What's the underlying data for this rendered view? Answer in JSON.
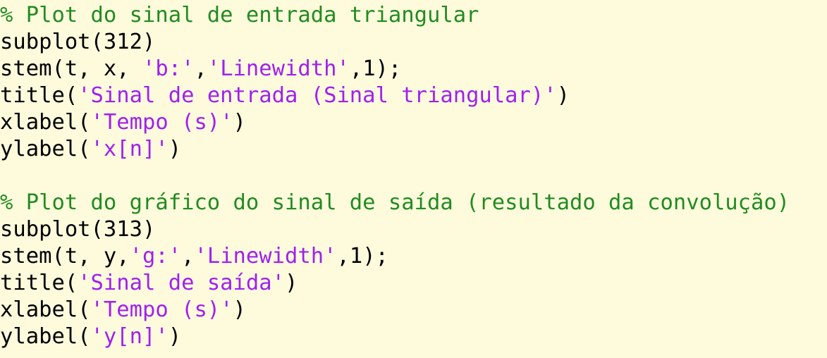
{
  "colors": {
    "background": "#fdfbdc",
    "code": "#000000",
    "comment": "#228b22",
    "string": "#a020f0"
  },
  "lines": [
    [
      {
        "t": "comment",
        "s": "% Plot do sinal de entrada triangular"
      }
    ],
    [
      {
        "t": "plain",
        "s": "subplot(312)"
      }
    ],
    [
      {
        "t": "plain",
        "s": "stem(t, x, "
      },
      {
        "t": "string",
        "s": "'b:'"
      },
      {
        "t": "plain",
        "s": ","
      },
      {
        "t": "string",
        "s": "'Linewidth'"
      },
      {
        "t": "plain",
        "s": ",1);"
      }
    ],
    [
      {
        "t": "plain",
        "s": "title("
      },
      {
        "t": "string",
        "s": "'Sinal de entrada (Sinal triangular)'"
      },
      {
        "t": "plain",
        "s": ")"
      }
    ],
    [
      {
        "t": "plain",
        "s": "xlabel("
      },
      {
        "t": "string",
        "s": "'Tempo (s)'"
      },
      {
        "t": "plain",
        "s": ")"
      }
    ],
    [
      {
        "t": "plain",
        "s": "ylabel("
      },
      {
        "t": "string",
        "s": "'x[n]'"
      },
      {
        "t": "plain",
        "s": ")"
      }
    ],
    [
      {
        "t": "plain",
        "s": ""
      }
    ],
    [
      {
        "t": "comment",
        "s": "% Plot do gráfico do sinal de saída (resultado da convolução)"
      }
    ],
    [
      {
        "t": "plain",
        "s": "subplot(313)"
      }
    ],
    [
      {
        "t": "plain",
        "s": "stem(t, y,"
      },
      {
        "t": "string",
        "s": "'g:'"
      },
      {
        "t": "plain",
        "s": ","
      },
      {
        "t": "string",
        "s": "'Linewidth'"
      },
      {
        "t": "plain",
        "s": ",1);"
      }
    ],
    [
      {
        "t": "plain",
        "s": "title("
      },
      {
        "t": "string",
        "s": "'Sinal de saída'"
      },
      {
        "t": "plain",
        "s": ")"
      }
    ],
    [
      {
        "t": "plain",
        "s": "xlabel("
      },
      {
        "t": "string",
        "s": "'Tempo (s)'"
      },
      {
        "t": "plain",
        "s": ")"
      }
    ],
    [
      {
        "t": "plain",
        "s": "ylabel("
      },
      {
        "t": "string",
        "s": "'y[n]'"
      },
      {
        "t": "plain",
        "s": ")"
      }
    ]
  ]
}
